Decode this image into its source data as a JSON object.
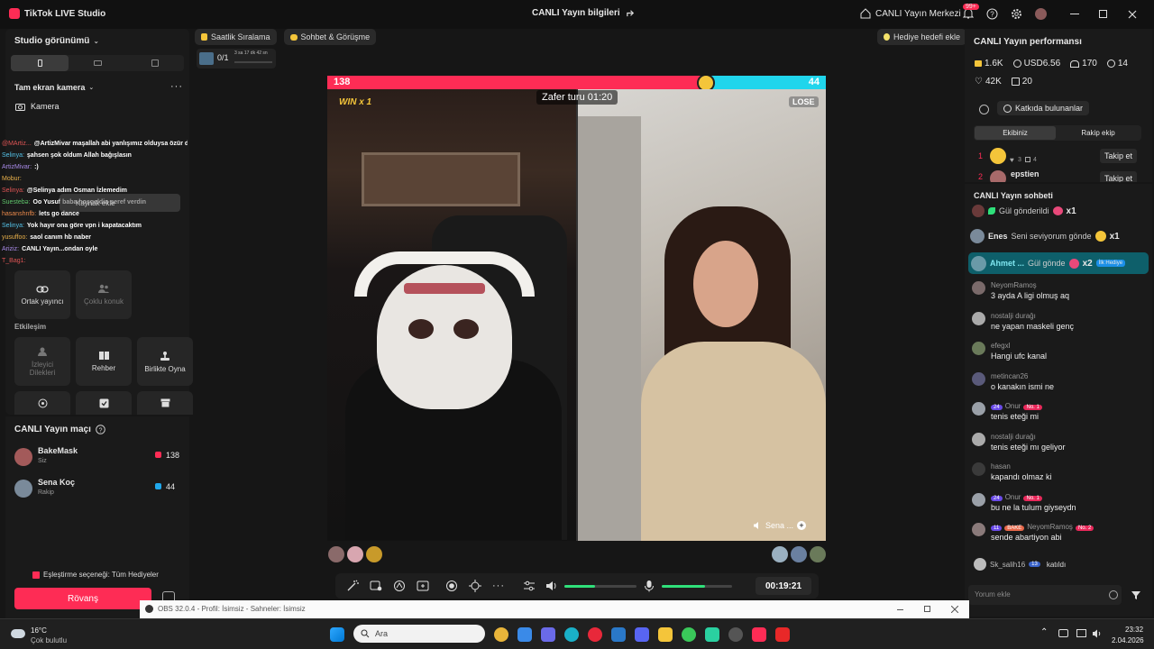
{
  "app": {
    "title": "TikTok LIVE Studio",
    "center_title": "CANLI Yayın bilgileri",
    "live_center": "CANLI Yayın Merkezi",
    "notif_count": "99+"
  },
  "left": {
    "studio_view": "Studio görünümü",
    "source_label": "Tam ekran kamera",
    "camera_label": "Kamera",
    "add_source": "Kaynak ekle",
    "chat": [
      {
        "user": "@MArtiz...",
        "text": "@ArtizMivar maşallah abi yanlışımız olduysa özür dileriz",
        "color": "#e05555"
      },
      {
        "user": "Selinya:",
        "text": "şahsen şok oldum Allah bağışlasın",
        "color": "#54c2e8"
      },
      {
        "user": "ArtizMivar:",
        "text": ":)",
        "color": "#a88ae8"
      },
      {
        "user": "Mobur:",
        "text": "",
        "color": "#e8b04a"
      },
      {
        "user": "Selinya:",
        "text": "@Selinya adım Osman İzlemedim",
        "color": "#e05555"
      },
      {
        "user": "Suestebə:",
        "text": "Oo Yusuf baba hoşgeldin şeref verdin",
        "color": "#5ec46a"
      },
      {
        "user": "hasanshnfb:",
        "text": "lets go dance",
        "color": "#e8884a"
      },
      {
        "user": "Selinya:",
        "text": "Yok hayır ona göre vpn i kapatacaktım",
        "color": "#54c2e8"
      },
      {
        "user": "yusuffoo:",
        "text": "saol canım hb naber",
        "color": "#e8b04a"
      },
      {
        "user": "Ariziz:",
        "text": "CANLI Yayın...ondan oyle",
        "color": "#a88ae8"
      },
      {
        "user": "T_Bag1:",
        "text": "",
        "color": "#e05555"
      }
    ],
    "collab": [
      {
        "label": "Ortak yayıncı"
      },
      {
        "label": "Çoklu konuk"
      }
    ],
    "interaction_title": "Etkileşim",
    "interaction": [
      {
        "label": "İzleyici Dilekleri"
      },
      {
        "label": "Rehber"
      },
      {
        "label": "Birlikte Oyna"
      }
    ],
    "match_title": "CANLI Yayın maçı",
    "players": [
      {
        "name": "BakeMask",
        "role": "Siz",
        "score": "138"
      },
      {
        "name": "Sena Koç",
        "role": "Rakip",
        "score": "44"
      }
    ],
    "match_option": "Eşleştirme seçeneği: Tüm Hediyeler",
    "rematch": "Rövanş"
  },
  "top_chips": {
    "ranking": "Saatlik Sıralama",
    "chat": "Sohbet & Görüşme",
    "gift_goal": "Hediye hedefi ekle"
  },
  "goal": {
    "value": "0/1",
    "timer": "3 sa 17 dk 42 sn"
  },
  "battle": {
    "left_score": "138",
    "right_score": "44",
    "win_label": "WIN x 1",
    "lose_label": "LOSE",
    "round": "Zafer turu 01:20",
    "opponent_tag": "Sena ...",
    "progress_left": 0.758
  },
  "controls": {
    "time": "00:19:21",
    "volume_level": 0.42,
    "mic_level": 0.62
  },
  "right": {
    "perf_title": "CANLI Yayın performansı",
    "stats": [
      "1.6K",
      "USD6.56",
      "170",
      "14",
      "42K",
      "20"
    ],
    "contributors": "Katkıda bulunanlar",
    "tabs": [
      "Ekibiniz",
      "Rakip ekip"
    ],
    "team": [
      {
        "rank": "1",
        "name": "",
        "hearts": "3",
        "gifts": "4",
        "follow": "Takip et"
      },
      {
        "rank": "2",
        "name": "epstien",
        "follow": "Takip et"
      }
    ],
    "chat_title": "CANLI Yayın sohbeti",
    "gifts": [
      {
        "user": "",
        "text": "Gül gönderildi",
        "mult": "x1"
      },
      {
        "user": "Enes",
        "text": "Seni seviyorum gönde",
        "mult": "x1"
      },
      {
        "user": "Ahmet ...",
        "text": "Gül gönde",
        "mult": "x2",
        "tag": "İlk Hediye"
      }
    ],
    "chat": [
      {
        "name": "NeyomRamoş",
        "msg": "3 ayda A ligi olmuş aq"
      },
      {
        "name": "nostalji durağı",
        "msg": "ne yapan maskeli genç"
      },
      {
        "name": "efegxl",
        "msg": "Hangi ufc kanal"
      },
      {
        "name": "metincan26",
        "msg": "o kanakın ismi ne"
      },
      {
        "name": "Onur",
        "lvl": "24",
        "rank": "No. 1",
        "msg": "tenis eteği mi"
      },
      {
        "name": "nostalji durağı",
        "msg": "tenis eteği mı geliyor"
      },
      {
        "name": "hasan",
        "msg": "kapandı olmaz ki"
      },
      {
        "name": "Onur",
        "lvl": "24",
        "rank": "No. 1",
        "msg": "bu ne la tulum giyseydn"
      },
      {
        "name": "NeyomRamoş",
        "lvl": "11",
        "team": "BAKE",
        "rank": "No. 2",
        "msg": "sende abartiyon abi"
      }
    ],
    "joined": {
      "name": "Sk_salih16",
      "lvl": "13",
      "text": "katıldı"
    },
    "comment_placeholder": "Yorum ekle"
  },
  "obs": {
    "title": "OBS 32.0.4 - Profil: İsimsiz - Sahneler: İsimsiz"
  },
  "taskbar": {
    "weather_temp": "16°C",
    "weather_text": "Çok bulutlu",
    "search": "Ara",
    "time": "23:32",
    "date": "2.04.2026"
  },
  "colors": {
    "accent": "#fe2c55",
    "cyan": "#20d5ec",
    "green": "#2fe07a"
  }
}
